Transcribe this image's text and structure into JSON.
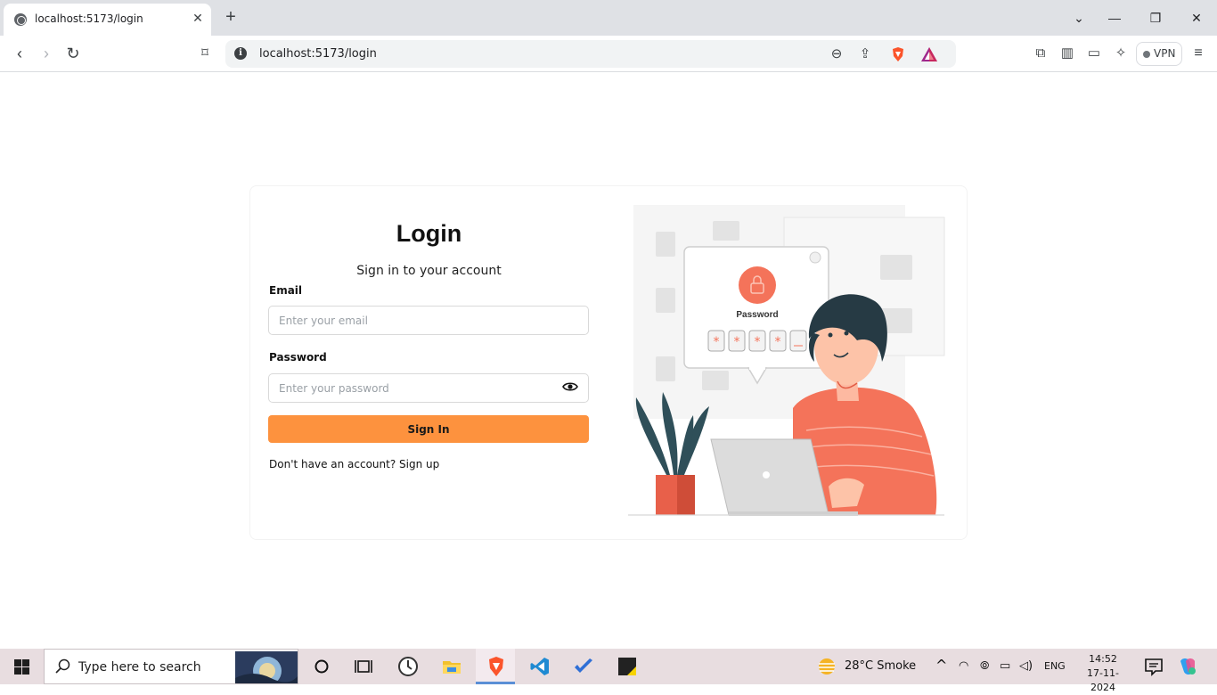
{
  "browser": {
    "tab_title": "localhost:5173/login",
    "url": "localhost:5173/login",
    "vpn_label": "VPN"
  },
  "login": {
    "title": "Login",
    "subtitle": "Sign in to your account",
    "email_label": "Email",
    "email_placeholder": "Enter your email",
    "password_label": "Password",
    "password_placeholder": "Enter your password",
    "submit_label": "Sign In",
    "signup_text": "Don't have an account? Sign up"
  },
  "illustration": {
    "caption": "Password"
  },
  "colors": {
    "accent": "#fd923e",
    "illustration_accent": "#f4735a"
  },
  "taskbar": {
    "search_placeholder": "Type here to search",
    "weather": "28°C  Smoke",
    "language": "ENG",
    "time": "14:52",
    "date": "17-11-2024"
  }
}
